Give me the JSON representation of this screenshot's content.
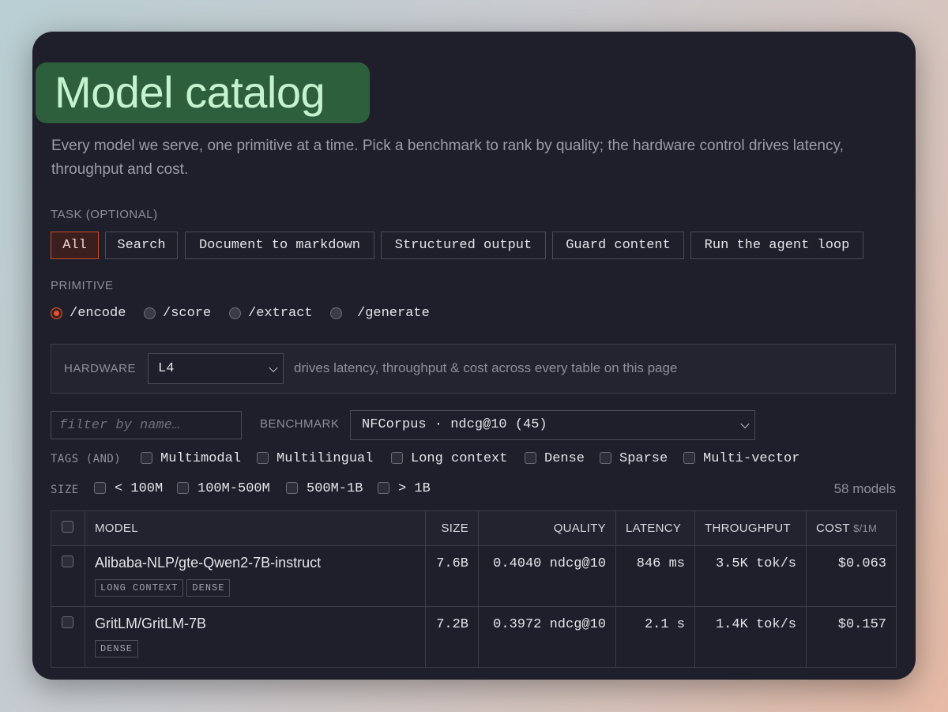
{
  "title": "Model catalog",
  "subtitle": "Every model we serve, one primitive at a time. Pick a benchmark to rank by quality; the hardware control drives latency, throughput and cost.",
  "task": {
    "label": "TASK (OPTIONAL)",
    "chips": [
      "All",
      "Search",
      "Document to markdown",
      "Structured output",
      "Guard content",
      "Run the agent loop"
    ],
    "active": "All"
  },
  "primitive": {
    "label": "PRIMITIVE",
    "options": [
      "/encode",
      "/score",
      "/extract",
      "/generate"
    ],
    "selected": "/encode"
  },
  "hardware": {
    "label": "HARDWARE",
    "value": "L4",
    "note": "drives latency, throughput & cost across every table on this page"
  },
  "filter": {
    "placeholder": "filter by name…"
  },
  "benchmark": {
    "label": "BENCHMARK",
    "value": "NFCorpus · ndcg@10 (45)"
  },
  "tags_filter": {
    "label": "TAGS (AND)",
    "options": [
      "Multimodal",
      "Multilingual",
      "Long context",
      "Dense",
      "Sparse",
      "Multi-vector"
    ]
  },
  "size_filter": {
    "label": "SIZE",
    "options": [
      "< 100M",
      "100M-500M",
      "500M-1B",
      "> 1B"
    ]
  },
  "model_count": "58 models",
  "table": {
    "headers": {
      "model": "MODEL",
      "size": "SIZE",
      "quality": "QUALITY",
      "latency": "LATENCY",
      "throughput": "THROUGHPUT",
      "cost": "COST",
      "cost_unit": "$/1M"
    },
    "rows": [
      {
        "model": "Alibaba-NLP/gte-Qwen2-7B-instruct",
        "tags": [
          "LONG CONTEXT",
          "DENSE"
        ],
        "size": "7.6B",
        "quality": "0.4040 ndcg@10",
        "latency": "846 ms",
        "throughput": "3.5K tok/s",
        "cost": "$0.063"
      },
      {
        "model": "GritLM/GritLM-7B",
        "tags": [
          "DENSE"
        ],
        "size": "7.2B",
        "quality": "0.3972 ndcg@10",
        "latency": "2.1 s",
        "throughput": "1.4K tok/s",
        "cost": "$0.157"
      }
    ]
  },
  "colors": {
    "accent": "#e4522f",
    "title_bg": "#2e5f3c",
    "title_fg": "#c6f3cf",
    "card_bg": "#1e1f2a"
  }
}
